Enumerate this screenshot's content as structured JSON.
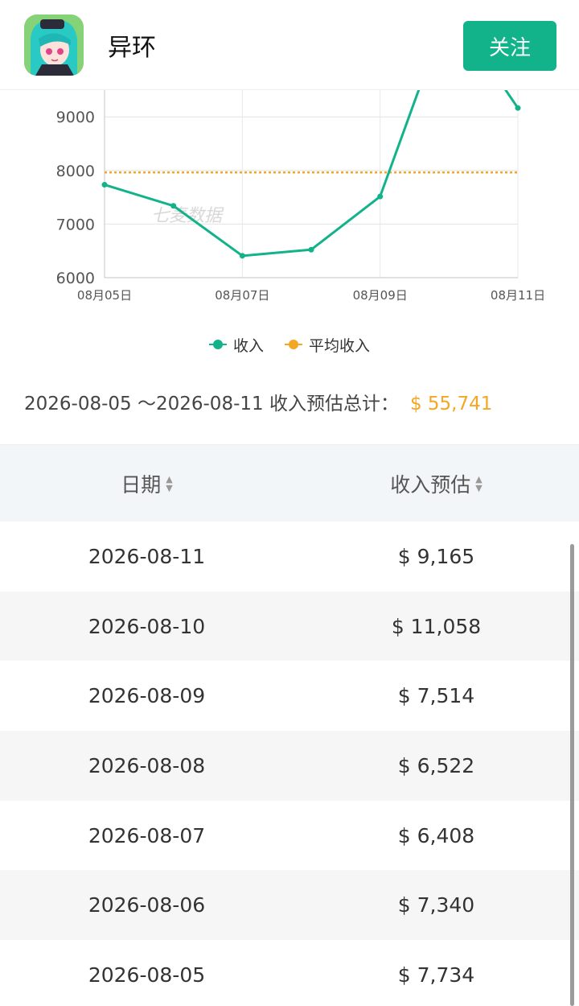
{
  "header": {
    "title": "异环",
    "follow_label": "关注"
  },
  "chart_data": {
    "type": "line",
    "watermark": "七麦数据",
    "x": [
      "08月05日",
      "08月06日",
      "08月07日",
      "08月08日",
      "08月09日",
      "08月10日",
      "08月11日"
    ],
    "x_tick_labels": [
      "08月05日",
      "08月07日",
      "08月09日",
      "08月11日"
    ],
    "y_tick_labels": [
      "6000",
      "7000",
      "8000",
      "9000"
    ],
    "ylim_visible": [
      6000,
      9500
    ],
    "series": [
      {
        "name": "收入",
        "color": "#12b38a",
        "values": [
          7734,
          7340,
          6408,
          6522,
          7514,
          11058,
          9165
        ]
      },
      {
        "name": "平均收入",
        "color": "#f5a623",
        "style": "dotted",
        "values": [
          7963,
          7963,
          7963,
          7963,
          7963,
          7963,
          7963
        ]
      }
    ],
    "legend": [
      "收入",
      "平均收入"
    ],
    "legend_position": "bottom",
    "grid": true
  },
  "legend": {
    "income": "收入",
    "avg_income": "平均收入"
  },
  "summary": {
    "text": "2026-08-05 ～2026-08-11 收入预估总计：",
    "total": "$ 55,741"
  },
  "table": {
    "headers": {
      "date": "日期",
      "revenue": "收入预估"
    },
    "rows": [
      {
        "date": "2026-08-11",
        "revenue": "$ 9,165"
      },
      {
        "date": "2026-08-10",
        "revenue": "$ 11,058"
      },
      {
        "date": "2026-08-09",
        "revenue": "$ 7,514"
      },
      {
        "date": "2026-08-08",
        "revenue": "$ 6,522"
      },
      {
        "date": "2026-08-07",
        "revenue": "$ 6,408"
      },
      {
        "date": "2026-08-06",
        "revenue": "$ 7,340"
      },
      {
        "date": "2026-08-05",
        "revenue": "$ 7,734"
      }
    ]
  },
  "colors": {
    "accent": "#12b38a",
    "average": "#f5a623"
  }
}
